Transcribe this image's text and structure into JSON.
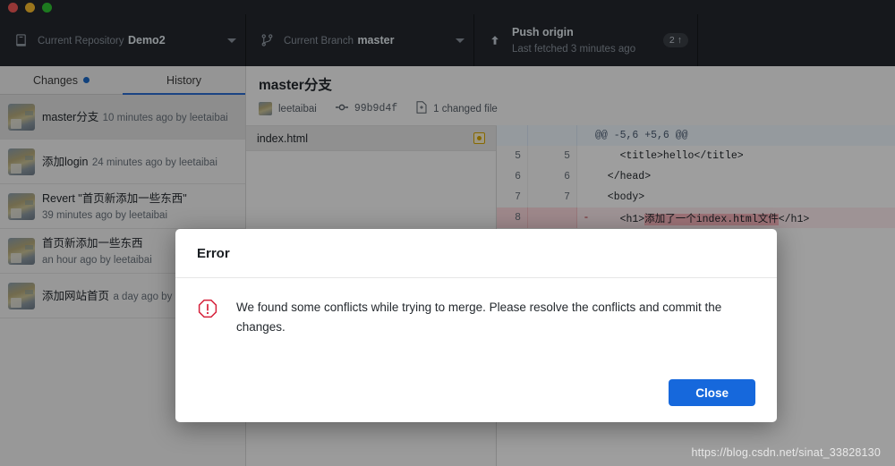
{
  "window": {
    "traffic_lights": [
      "close",
      "minimize",
      "zoom"
    ]
  },
  "toolbar": {
    "repository": {
      "label": "Current Repository",
      "value": "Demo2",
      "icon": "repo-icon"
    },
    "branch": {
      "label": "Current Branch",
      "value": "master",
      "icon": "branch-icon"
    },
    "push": {
      "label": "Push origin",
      "value": "Last fetched 3 minutes ago",
      "icon": "arrow-up-icon",
      "badge_count": "2",
      "badge_arrow": "↑"
    }
  },
  "sidebar": {
    "tabs": [
      {
        "label": "Changes",
        "active": false,
        "has_dot": true
      },
      {
        "label": "History",
        "active": true,
        "has_dot": false
      }
    ],
    "commits": [
      {
        "title": "master分支",
        "sub": "10 minutes ago by leetaibai",
        "selected": true
      },
      {
        "title": "添加login",
        "sub": "24 minutes ago by leetaibai",
        "selected": false
      },
      {
        "title": "Revert \"首页新添加一些东西\"",
        "sub": "39 minutes ago by leetaibai",
        "selected": false
      },
      {
        "title": "首页新添加一些东西",
        "sub": "an hour ago by leetaibai",
        "selected": false
      },
      {
        "title": "添加网站首页",
        "sub": "a day ago by leetaibai",
        "selected": false
      }
    ]
  },
  "commit_detail": {
    "title": "master分支",
    "author": "leetaibai",
    "sha": "99b9d4f",
    "changed_files": "1 changed file",
    "file": {
      "name": "index.html",
      "status": "modified"
    }
  },
  "diff": {
    "lines": [
      {
        "type": "hunk",
        "old": "",
        "new": "",
        "mark": "",
        "code": "@@ -5,6 +5,6 @@"
      },
      {
        "type": "ctx",
        "old": "5",
        "new": "5",
        "mark": "",
        "code": "    <title>hello</title>"
      },
      {
        "type": "ctx",
        "old": "6",
        "new": "6",
        "mark": "",
        "code": "  </head>"
      },
      {
        "type": "ctx",
        "old": "7",
        "new": "7",
        "mark": "",
        "code": "  <body>"
      },
      {
        "type": "del",
        "old": "8",
        "new": "",
        "mark": "-",
        "code_pre": "    <h1>",
        "code_hl": "添加了一个index.html文件",
        "code_post": "</h1>"
      }
    ]
  },
  "modal": {
    "title": "Error",
    "icon": "error-octagon-icon",
    "message": "We found some conflicts while trying to merge. Please resolve the conflicts and commit the changes.",
    "close_label": "Close",
    "accent": "#1668dc"
  },
  "watermark": {
    "text": "https://blog.csdn.net/sinat_33828130"
  }
}
